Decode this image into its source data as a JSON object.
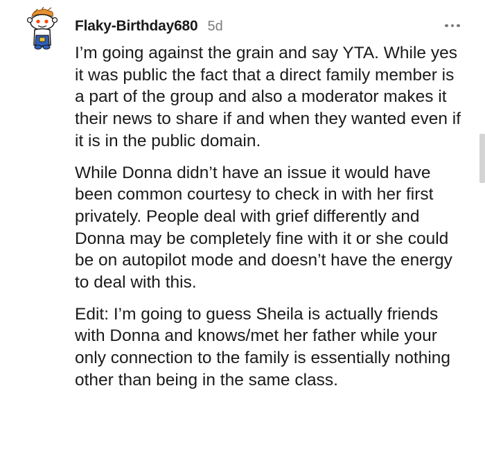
{
  "comment": {
    "username": "Flaky-Birthday680",
    "age": "5d",
    "avatar_icon": "snoo-avatar-icon",
    "more_icon": "more-options-icon",
    "paragraphs": [
      "I’m going against the grain and say YTA. While yes it was public the fact that a direct family member is a part of the group and also a moderator makes it their news to share if and when they wanted even if it is in the public domain.",
      "While Donna didn’t have an issue it would have been common courtesy to check in with her first privately. People deal with grief differently and Donna may be completely fine with it or she could be on autopilot mode and doesn’t have the energy to deal with this.",
      "Edit: I’m going to guess Sheila is actually friends with Donna and knows/met her father while your only connection to the family is essentially nothing other than being in the same class."
    ]
  },
  "colors": {
    "text": "#1a1a1b",
    "meta": "#7c7c7c",
    "avatar_hair": "#e8912f",
    "avatar_shirt": "#2f5fb8"
  }
}
